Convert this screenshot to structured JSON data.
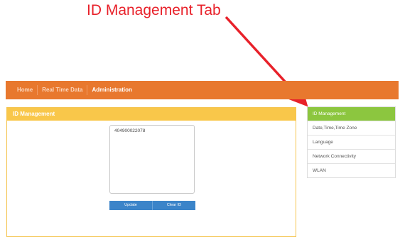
{
  "annotation": {
    "text": "ID Management Tab",
    "color": "#e8212a"
  },
  "navbar": {
    "items": [
      {
        "label": "Home"
      },
      {
        "label": "Real Time Data"
      },
      {
        "label": "Administration",
        "active": true
      }
    ],
    "color": "#e8782e"
  },
  "panel": {
    "title": "ID Management",
    "header_color": "#f9c74a",
    "id_value": "404900022078",
    "buttons": {
      "update": "Update",
      "clear": "Clear ID"
    }
  },
  "sidemenu": {
    "items": [
      {
        "label": "ID Management",
        "active": true
      },
      {
        "label": "Date,Time,Time Zone"
      },
      {
        "label": "Language"
      },
      {
        "label": "Network Connectivity"
      },
      {
        "label": "WLAN"
      }
    ],
    "active_color": "#8cc63f"
  }
}
